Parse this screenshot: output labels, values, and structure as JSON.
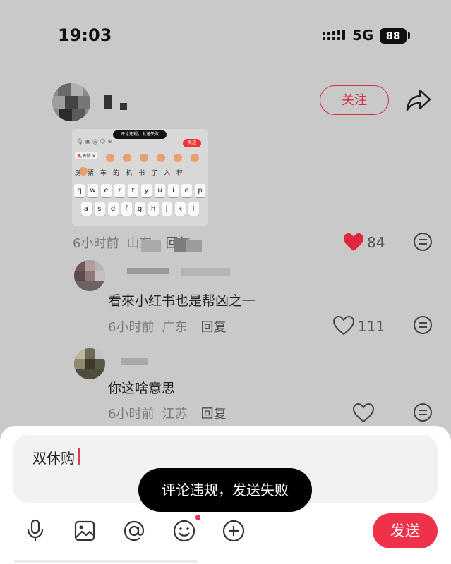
{
  "status_bar": {
    "time": "19:03",
    "network": "5G",
    "battery": "88"
  },
  "post": {
    "follow_label": "关注"
  },
  "embedded_screenshot": {
    "toast": "评论违规，发送失败",
    "send_label": "发送",
    "chip": "🔖表情 ✕",
    "candidates": [
      "房",
      "票",
      "车",
      "的",
      "机",
      "书",
      "了",
      "入",
      "秤"
    ],
    "keyboard_rows": [
      [
        "q",
        "w",
        "e",
        "r",
        "t",
        "y",
        "u",
        "i",
        "o",
        "p"
      ],
      [
        "a",
        "s",
        "d",
        "f",
        "g",
        "h",
        "j",
        "k",
        "l"
      ]
    ]
  },
  "post_meta": {
    "time": "6小时前",
    "location": "山东",
    "reply": "回复",
    "likes": "84"
  },
  "comments": [
    {
      "text": "看來小红书也是帮凶之一",
      "time": "6小时前",
      "location": "广东",
      "reply": "回复",
      "likes": "111"
    },
    {
      "text": "你这啥意思",
      "time": "6小时前",
      "location": "江苏",
      "reply": "回复",
      "likes": ""
    }
  ],
  "composer": {
    "input_value": "双休购",
    "toast": "评论违规，发送失败",
    "send_label": "发送"
  },
  "colors": {
    "accent": "#f0314a",
    "follow": "#d6314a",
    "heart": "#e0253f"
  },
  "icons": [
    "signal-icon",
    "share-icon",
    "heart-icon",
    "more-icon",
    "mic-icon",
    "image-icon",
    "at-icon",
    "emoji-icon",
    "plus-icon"
  ]
}
